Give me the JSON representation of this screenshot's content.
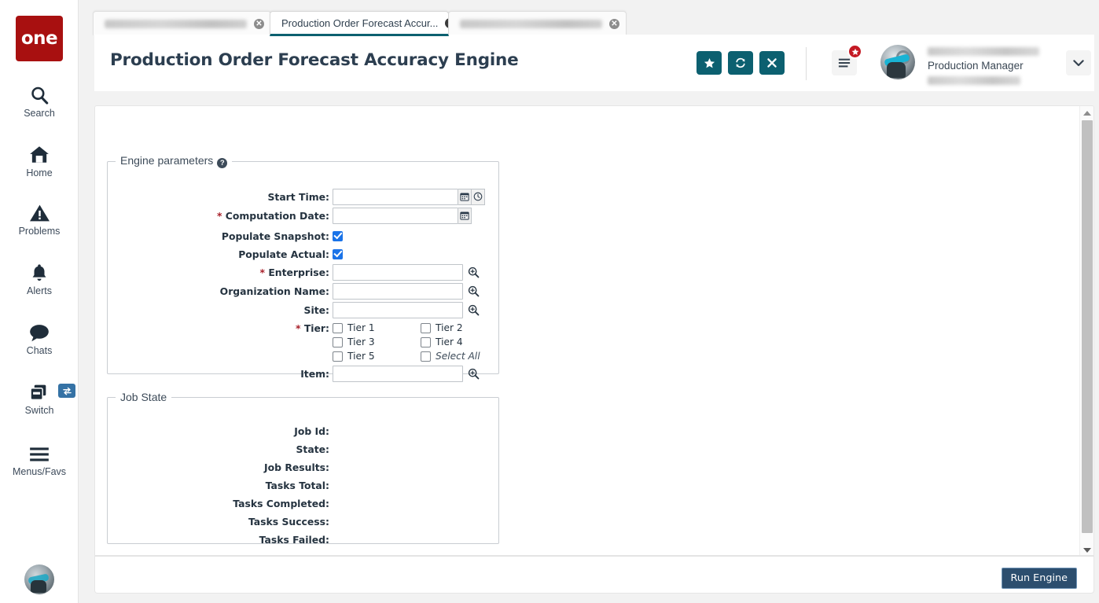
{
  "app": {
    "logo_text": "one",
    "page_title": "Production Order Forecast Accuracy Engine"
  },
  "rail": {
    "items": [
      {
        "icon": "search-icon",
        "label": "Search"
      },
      {
        "icon": "home-icon",
        "label": "Home"
      },
      {
        "icon": "warning-icon",
        "label": "Problems"
      },
      {
        "icon": "bell-icon",
        "label": "Alerts"
      },
      {
        "icon": "chat-icon",
        "label": "Chats"
      },
      {
        "icon": "windows-icon",
        "label": "Switch"
      },
      {
        "icon": "hamburger-icon",
        "label": "Menus/Favs"
      }
    ],
    "switch_badge_icon": "swap-arrows-icon",
    "avatar_name": "user-avatar-small"
  },
  "tabs": [
    {
      "label": "",
      "active": false,
      "redacted": true
    },
    {
      "label": "Production Order Forecast Accur...",
      "active": true,
      "redacted": false
    },
    {
      "label": "",
      "active": false,
      "redacted": true
    }
  ],
  "header": {
    "buttons": [
      {
        "name": "favorite-button",
        "icon": "star-icon",
        "glyph": "★"
      },
      {
        "name": "refresh-button",
        "icon": "refresh-icon",
        "glyph": "↻"
      },
      {
        "name": "close-button",
        "icon": "close-icon",
        "glyph": "✕"
      }
    ],
    "menu_icon": "hamburger-icon",
    "menu_badge_icon": "star-badge-icon",
    "user_role": "Production Manager",
    "caret_icon": "chevron-down-icon",
    "accent_color": "#0c6070",
    "badge_color": "#c41a24"
  },
  "engine_parameters": {
    "legend": "Engine parameters",
    "help_icon": "help-question-icon",
    "fields": [
      {
        "label": "Start Time:",
        "required": false,
        "type": "datetime",
        "value": "",
        "icons": [
          "calendar-icon",
          "clock-icon"
        ]
      },
      {
        "label": "Computation Date:",
        "required": true,
        "type": "date",
        "value": "",
        "icons": [
          "calendar-icon"
        ]
      },
      {
        "label": "Populate Snapshot:",
        "required": false,
        "type": "checkbox",
        "checked": true
      },
      {
        "label": "Populate Actual:",
        "required": false,
        "type": "checkbox",
        "checked": true
      },
      {
        "label": "Enterprise:",
        "required": true,
        "type": "lookup",
        "value": "",
        "icons": [
          "search-plus-icon"
        ]
      },
      {
        "label": "Organization Name:",
        "required": false,
        "type": "lookup",
        "value": "",
        "icons": [
          "search-plus-icon"
        ]
      },
      {
        "label": "Site:",
        "required": false,
        "type": "lookup",
        "value": "",
        "icons": [
          "search-plus-icon"
        ]
      }
    ],
    "tier": {
      "label": "Tier:",
      "required": true,
      "options": [
        {
          "label": "Tier 1",
          "checked": false
        },
        {
          "label": "Tier 2",
          "checked": false
        },
        {
          "label": "Tier 3",
          "checked": false
        },
        {
          "label": "Tier 4",
          "checked": false
        },
        {
          "label": "Tier 5",
          "checked": false
        },
        {
          "label": "Select All",
          "checked": false,
          "is_select_all": true
        }
      ]
    },
    "item_field": {
      "label": "Item:",
      "required": false,
      "type": "lookup",
      "value": "",
      "icons": [
        "search-plus-icon"
      ]
    }
  },
  "job_state": {
    "legend": "Job State",
    "rows": [
      {
        "label": "Job Id:",
        "value": ""
      },
      {
        "label": "State:",
        "value": ""
      },
      {
        "label": "Job Results:",
        "value": ""
      },
      {
        "label": "Tasks Total:",
        "value": ""
      },
      {
        "label": "Tasks Completed:",
        "value": ""
      },
      {
        "label": "Tasks Success:",
        "value": ""
      },
      {
        "label": "Tasks Failed:",
        "value": ""
      }
    ]
  },
  "footer": {
    "run_engine_label": "Run Engine",
    "run_engine_color": "#2c4e6e"
  },
  "scrollbar": {
    "up_icon": "triangle-up-icon",
    "down_icon": "triangle-down-icon"
  }
}
